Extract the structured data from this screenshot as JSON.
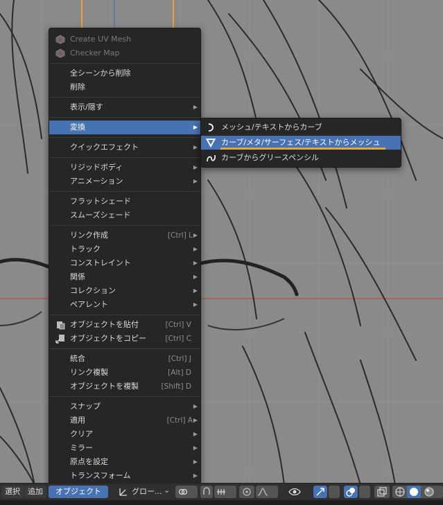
{
  "header": {
    "select_label": "選択",
    "add_label": "追加",
    "object_label": "オブジェクト",
    "pivot_dropdown_label": "グロー...",
    "chevron": "⌄",
    "icons": [
      "transform-pivot-icon",
      "link-icon",
      "snap-icon",
      "snap-grid-icon",
      "proportional-edit-icon",
      "falloff-icon",
      "visibility-icon",
      "gizmo-icon",
      "overlay-icon",
      "xray-icon",
      "wireframe-shading-icon",
      "solid-shading-icon",
      "material-shading-icon"
    ]
  },
  "main_menu": {
    "items": [
      {
        "label": "Create UV Mesh",
        "disabled": true,
        "icon": "addon-icon"
      },
      {
        "label": "Checker Map",
        "disabled": true,
        "icon": "addon-icon"
      },
      {
        "label": "全シーンから削除"
      },
      {
        "label": "削除"
      },
      {
        "label": "表示/隠す",
        "submenu": true
      },
      {
        "label": "変換",
        "submenu": true,
        "active": true
      },
      {
        "label": "クイックエフェクト",
        "submenu": true
      },
      {
        "label": "リジッドボディ",
        "submenu": true
      },
      {
        "label": "アニメーション",
        "submenu": true
      },
      {
        "label": "フラットシェード"
      },
      {
        "label": "スムーズシェード"
      },
      {
        "label": "リンク作成",
        "shortcut": "[Ctrl] L",
        "submenu": true
      },
      {
        "label": "トラック",
        "submenu": true
      },
      {
        "label": "コンストレイント",
        "submenu": true
      },
      {
        "label": "関係",
        "submenu": true
      },
      {
        "label": "コレクション",
        "submenu": true
      },
      {
        "label": "ペアレント",
        "submenu": true
      },
      {
        "label": "オブジェクトを貼付",
        "shortcut": "[Ctrl] V",
        "icon": "paste-icon"
      },
      {
        "label": "オブジェクトをコピー",
        "shortcut": "[Ctrl] C",
        "icon": "copy-icon"
      },
      {
        "label": "統合",
        "shortcut": "[Ctrl] J"
      },
      {
        "label": "リンク複製",
        "shortcut": "[Alt] D"
      },
      {
        "label": "オブジェクトを複製",
        "shortcut": "[Shift] D"
      },
      {
        "label": "スナップ",
        "submenu": true
      },
      {
        "label": "適用",
        "shortcut": "[Ctrl] A",
        "submenu": true
      },
      {
        "label": "クリア",
        "submenu": true
      },
      {
        "label": "ミラー",
        "submenu": true
      },
      {
        "label": "原点を設定",
        "submenu": true
      },
      {
        "label": "トランスフォーム",
        "submenu": true
      }
    ]
  },
  "convert_submenu": {
    "items": [
      {
        "label": "メッシュ/テキストからカーブ",
        "icon": "curve-icon"
      },
      {
        "label": "カーブ/メタ/サーフェス/テキストからメッシュ",
        "icon": "mesh-triangle-icon",
        "active": true
      },
      {
        "label": "カーブからグリースペンシル",
        "icon": "grease-pencil-icon"
      }
    ]
  },
  "colors": {
    "menu_bg": "#262626",
    "highlight": "#4772b3",
    "accent_underline": "#e8a43a",
    "viewport_bg": "#8a8a8a",
    "axis_red": "#c04040"
  },
  "submenu_arrow": "▶"
}
